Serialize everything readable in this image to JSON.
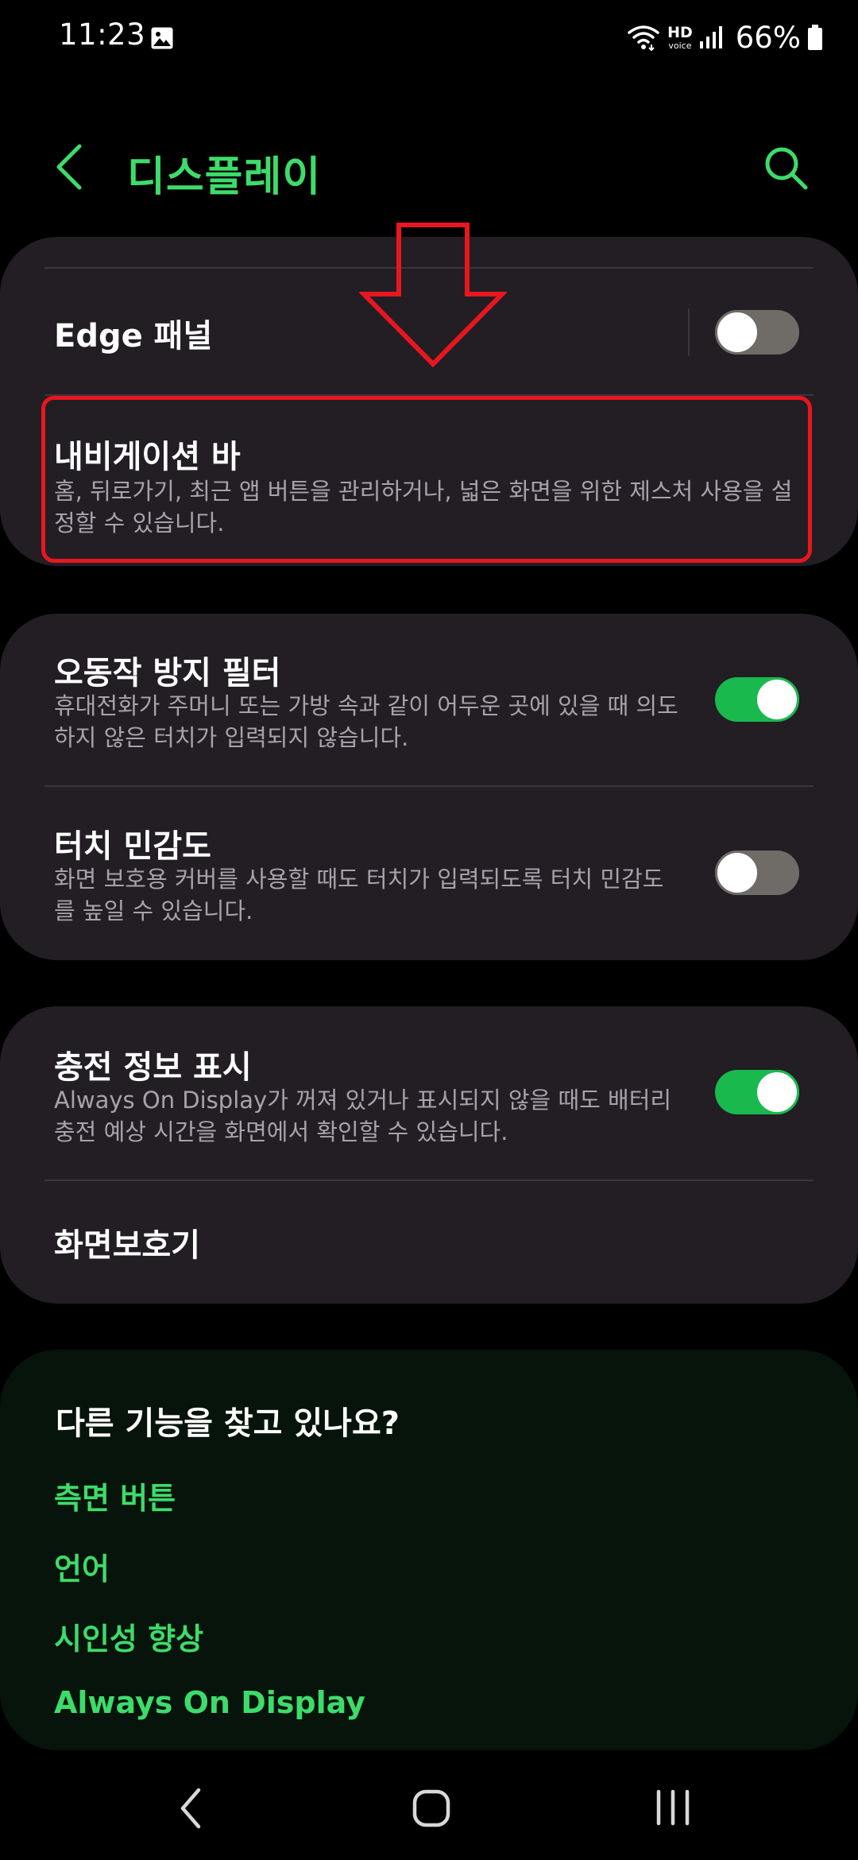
{
  "status_bar": {
    "time": "11:23",
    "hd_label": "HD",
    "voice_label": "voice",
    "battery": "66%"
  },
  "header": {
    "title": "디스플레이"
  },
  "settings": {
    "edge_panel": {
      "title": "Edge 패널",
      "enabled": false
    },
    "navigation_bar": {
      "title": "내비게이션 바",
      "subtitle": "홈, 뒤로가기, 최근 앱 버튼을 관리하거나, 넓은 화면을 위한 제스처 사용을 설정할 수 있습니다."
    },
    "accidental_touch": {
      "title": "오동작 방지 필터",
      "subtitle": "휴대전화가 주머니 또는 가방 속과 같이 어두운 곳에 있을 때 의도하지 않은 터치가 입력되지 않습니다.",
      "enabled": true
    },
    "touch_sensitivity": {
      "title": "터치 민감도",
      "subtitle": "화면 보호용 커버를 사용할 때도 터치가 입력되도록 터치 민감도를 높일 수 있습니다.",
      "enabled": false
    },
    "charging_info": {
      "title": "충전 정보 표시",
      "subtitle": "Always On Display가 꺼져 있거나 표시되지 않을 때도 배터리 충전 예상 시간을 화면에서 확인할 수 있습니다.",
      "enabled": true
    },
    "screen_saver": {
      "title": "화면보호기"
    }
  },
  "suggestions": {
    "title": "다른 기능을 찾고 있나요?",
    "links": [
      "측면 버튼",
      "언어",
      "시인성 향상",
      "Always On Display"
    ]
  },
  "colors": {
    "accent_green": "#3ddc6a",
    "toggle_on": "#19b94e",
    "highlight_red": "#e8161f",
    "card_bg": "#221e24"
  },
  "icons": {
    "status": [
      "gallery-icon",
      "wifi-icon",
      "signal-icon",
      "battery-icon"
    ],
    "header": [
      "back-arrow-icon",
      "search-icon"
    ],
    "nav": [
      "nav-back-icon",
      "nav-home-icon",
      "nav-recents-icon"
    ]
  }
}
